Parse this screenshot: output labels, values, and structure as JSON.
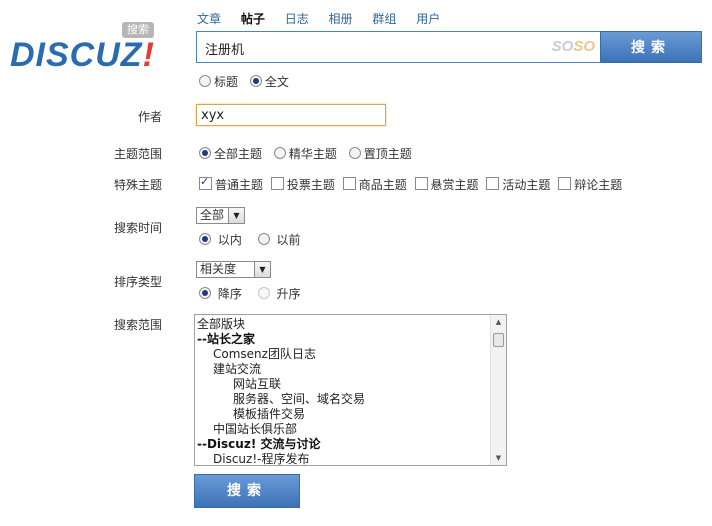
{
  "header": {
    "logo_text": "DISCUZ",
    "logo_bang": "!",
    "logo_badge": "搜索",
    "tabs": [
      {
        "label": "文章",
        "active": false
      },
      {
        "label": "帖子",
        "active": true
      },
      {
        "label": "日志",
        "active": false
      },
      {
        "label": "相册",
        "active": false
      },
      {
        "label": "群组",
        "active": false
      },
      {
        "label": "用户",
        "active": false
      }
    ],
    "search_value": "注册机",
    "soso_a": "SO",
    "soso_b": "SO",
    "search_button": "搜索"
  },
  "search_scope": {
    "options": [
      {
        "label": "标题",
        "selected": false
      },
      {
        "label": "全文",
        "selected": true
      }
    ]
  },
  "author": {
    "label": "作者",
    "value": "xyx"
  },
  "topic_range": {
    "label": "主题范围",
    "options": [
      {
        "label": "全部主题",
        "selected": true
      },
      {
        "label": "精华主题",
        "selected": false
      },
      {
        "label": "置顶主题",
        "selected": false
      }
    ]
  },
  "special_topic": {
    "label": "特殊主题",
    "options": [
      {
        "label": "普通主题",
        "checked": true
      },
      {
        "label": "投票主题",
        "checked": false
      },
      {
        "label": "商品主题",
        "checked": false
      },
      {
        "label": "悬赏主题",
        "checked": false
      },
      {
        "label": "活动主题",
        "checked": false
      },
      {
        "label": "辩论主题",
        "checked": false
      }
    ]
  },
  "search_time": {
    "label": "搜索时间",
    "select_value": "全部",
    "options": [
      {
        "label": "以内",
        "selected": true
      },
      {
        "label": "以前",
        "selected": false
      }
    ]
  },
  "sort_type": {
    "label": "排序类型",
    "select_value": "相关度",
    "options": [
      {
        "label": "降序",
        "selected": true
      },
      {
        "label": "升序",
        "selected": false,
        "disabled": true
      }
    ]
  },
  "forum_range": {
    "label": "搜索范围",
    "items": [
      {
        "label": "全部版块",
        "level": 0,
        "group": false
      },
      {
        "label": "--站长之家",
        "level": 0,
        "group": true
      },
      {
        "label": "Comsenz团队日志",
        "level": 1,
        "group": false
      },
      {
        "label": "建站交流",
        "level": 1,
        "group": false
      },
      {
        "label": "网站互联",
        "level": 2,
        "group": false
      },
      {
        "label": "服务器、空间、域名交易",
        "level": 2,
        "group": false
      },
      {
        "label": "模板插件交易",
        "level": 2,
        "group": false
      },
      {
        "label": "中国站长俱乐部",
        "level": 1,
        "group": false
      },
      {
        "label": "--Discuz! 交流与讨论",
        "level": 0,
        "group": true
      },
      {
        "label": "Discuz!-程序发布",
        "level": 1,
        "group": false
      }
    ]
  },
  "submit_button": "搜索",
  "colors": {
    "accent": "#3d72b8",
    "link": "#336699",
    "logo_blue": "#2b6cb0",
    "logo_red": "#e63b2e",
    "input_focus": "#d6a94a"
  }
}
